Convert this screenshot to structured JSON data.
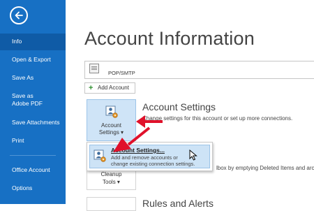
{
  "sidebar": {
    "items": [
      {
        "label": "Info",
        "active": true
      },
      {
        "label": "Open & Export"
      },
      {
        "label": "Save As"
      },
      {
        "label": "Save as Adobe PDF"
      },
      {
        "label": "Save Attachments"
      },
      {
        "label": "Print"
      },
      {
        "label": "Office Account"
      },
      {
        "label": "Options"
      }
    ]
  },
  "main": {
    "title": "Account Information",
    "account_selector": {
      "value": "POP/SMTP"
    },
    "add_account_label": "Add Account",
    "account_settings": {
      "button_line1": "Account",
      "button_line2": "Settings ▾",
      "title": "Account Settings",
      "description": "Change settings for this account or set up more connections."
    },
    "dropdown_item": {
      "title": "Account Settings...",
      "description_line1": "Add and remove accounts or",
      "description_line2": "change existing connection settings."
    },
    "cleanup": {
      "button_line1": "Cleanup",
      "button_line2": "Tools ▾",
      "description_fragment": "lbox by emptying Deleted Items and arc"
    },
    "next_section_title": "Rules and Alerts"
  },
  "colors": {
    "sidebar_bg": "#1770c4",
    "sidebar_active": "#0f5ba6",
    "highlight": "#cde3f6",
    "annotation_arrow": "#e0112b"
  },
  "icons": [
    "back-arrow-icon",
    "account-settings-icon",
    "plus-icon",
    "mouse-cursor-icon",
    "annotation-arrow-icon"
  ]
}
